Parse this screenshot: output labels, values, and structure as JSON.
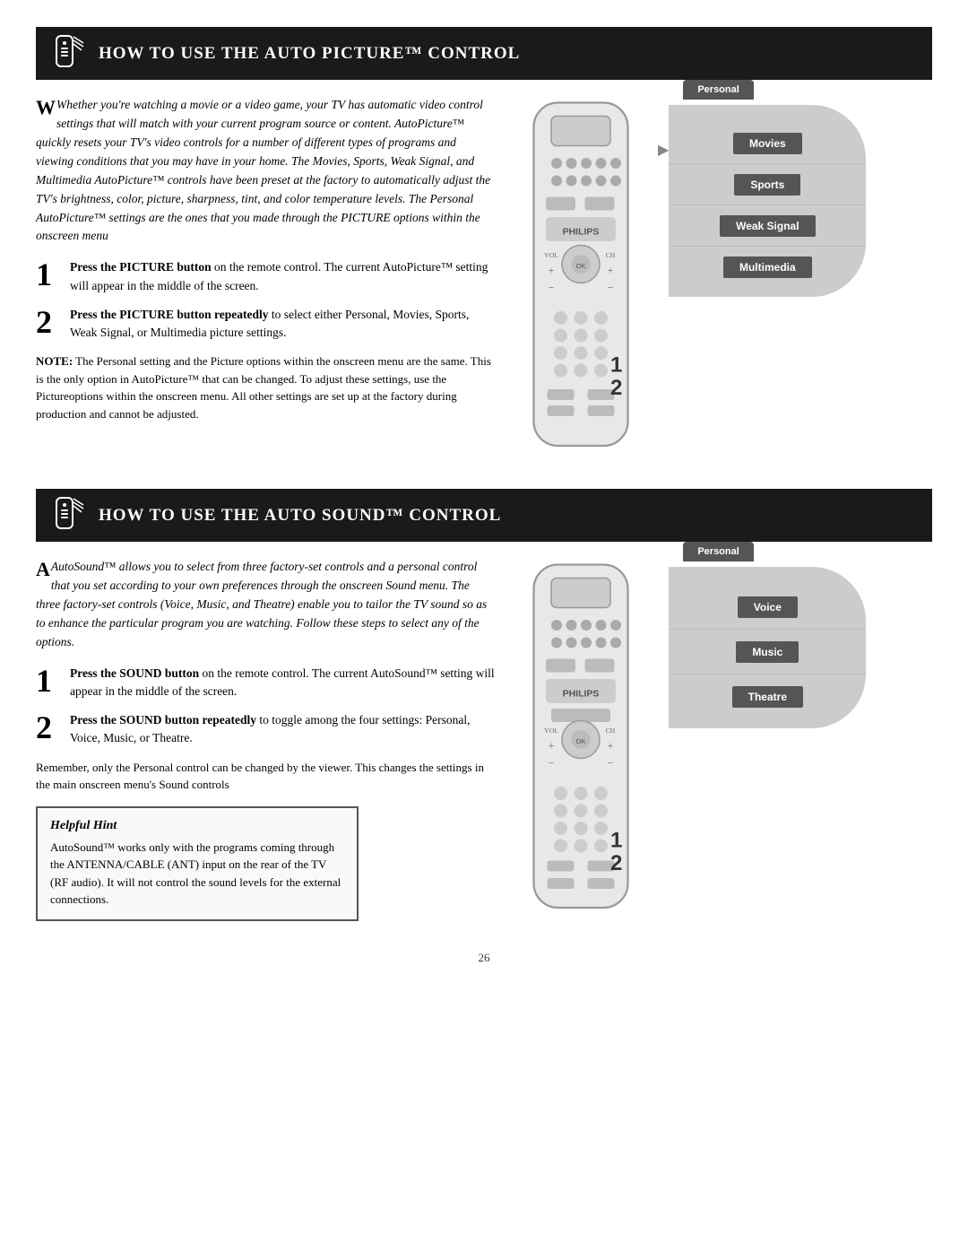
{
  "section1": {
    "header": "How to Use the Auto Picture™ Control",
    "intro": "Whether you're watching a movie or a video game, your TV has automatic video control settings that will match with your current program source or content. AutoPicture™ quickly resets your TV's video controls for a number of different types of programs and viewing conditions that you may have in your home. The Movies, Sports, Weak Signal, and Multimedia AutoPicture™ controls have been preset at the factory to automatically adjust the TV's brightness, color, picture, sharpness, tint, and color temperature levels. The Personal AutoPicture™ settings are the ones that you made through the PICTURE options within the onscreen menu",
    "step1": {
      "num": "1",
      "bold": "Press the PICTURE button",
      "text": " on the remote control. The current AutoPicture™ setting will appear in the middle of the screen."
    },
    "step2": {
      "num": "2",
      "bold": "Press the PICTURE button repeatedly",
      "text": " to select either Personal, Movies, Sports, Weak Signal, or Multimedia picture settings."
    },
    "note": {
      "label": "NOTE:",
      "text": " The Personal setting and the Picture options within the onscreen menu are the same. This is the only option in AutoPicture™ that can be changed. To adjust these settings, use the Pictureoptions within the onscreen menu. All other settings are set up at the factory during production and cannot be adjusted."
    },
    "options": [
      "Personal",
      "Movies",
      "Sports",
      "Weak Signal",
      "Multimedia"
    ]
  },
  "section2": {
    "header": "How to Use the Auto Sound™ Control",
    "intro": "AutoSound™ allows you to select from three factory-set controls and a personal control that you set according to your own preferences through the onscreen Sound menu. The three factory-set controls (Voice, Music, and Theatre) enable you to tailor the TV sound so as to enhance the particular program you are watching. Follow these steps to select any of the options.",
    "step1": {
      "num": "1",
      "bold": "Press the SOUND button",
      "text": " on the remote control. The current AutoSound™ setting will appear in the middle of the screen."
    },
    "step2": {
      "num": "2",
      "bold": "Press the SOUND button repeatedly",
      "text": " to toggle among the four settings: Personal, Voice, Music, or Theatre."
    },
    "reminder": "Remember, only the Personal control can be changed by the viewer. This changes the settings in the main onscreen menu's Sound controls",
    "hint": {
      "heading": "Helpful Hint",
      "text": "AutoSound™ works only with the programs coming through the ANTENNA/CABLE (ANT) input on the rear of the TV (RF audio). It will not control the sound levels for the external connections."
    },
    "options": [
      "Personal",
      "Voice",
      "Music",
      "Theatre"
    ]
  },
  "page_number": "26"
}
